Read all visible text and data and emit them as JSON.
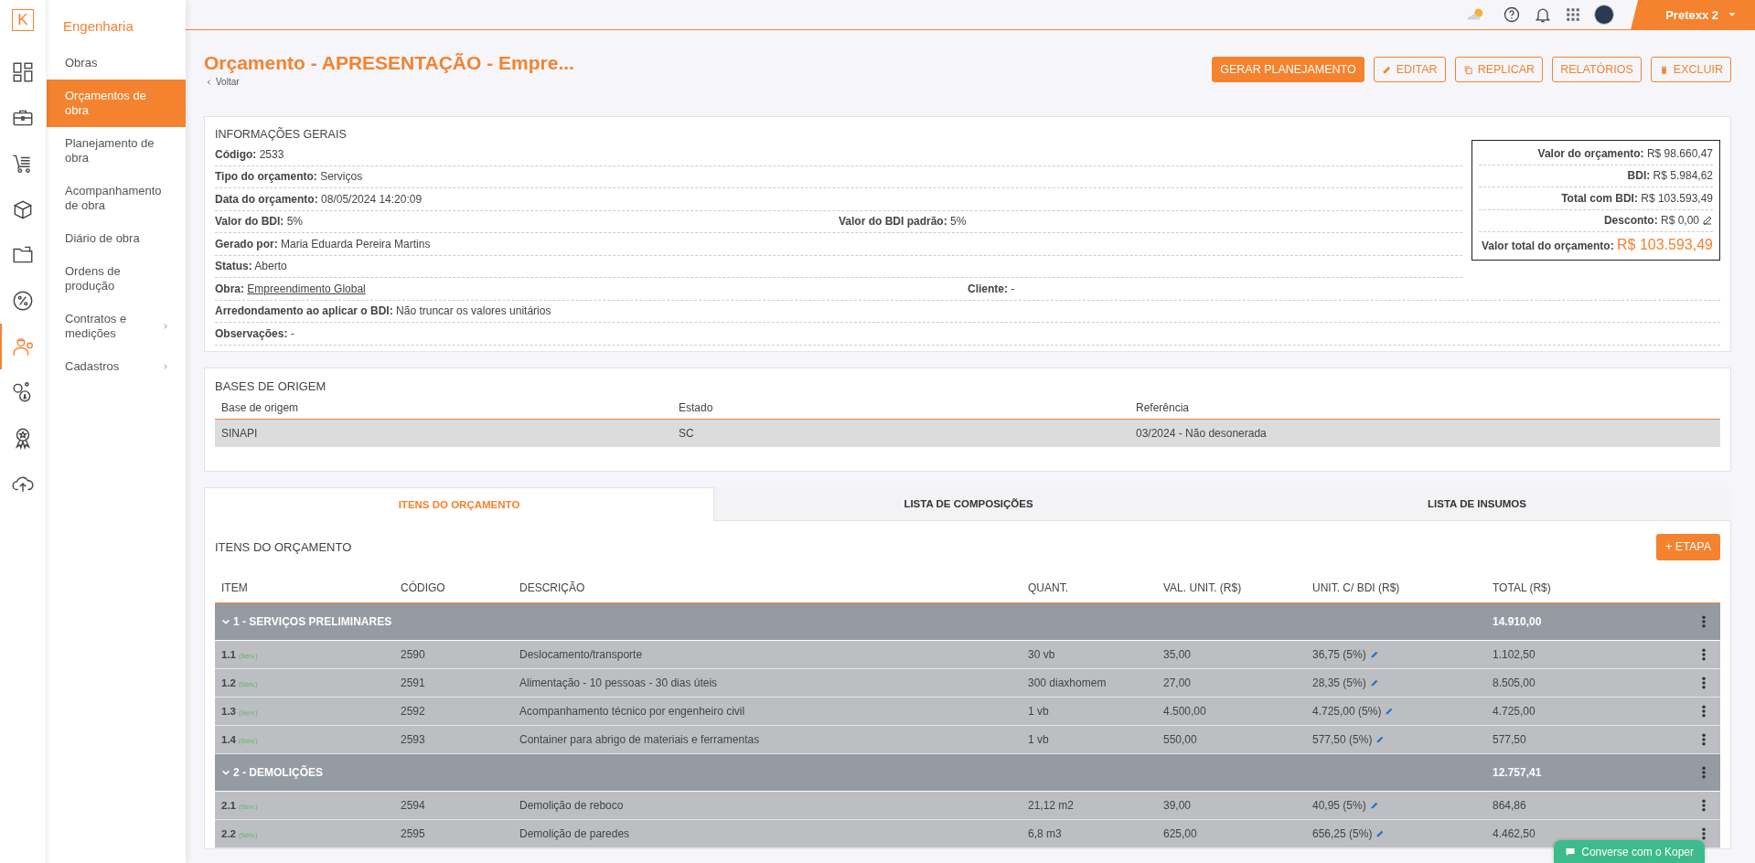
{
  "rail": {
    "logo": "K",
    "items": [
      {
        "selected": false
      },
      {
        "selected": false
      },
      {
        "selected": false
      },
      {
        "selected": false
      },
      {
        "selected": false
      },
      {
        "selected": false
      },
      {
        "selected": true
      },
      {
        "selected": false
      },
      {
        "selected": false
      },
      {
        "selected": false
      }
    ]
  },
  "sidebar": {
    "title": "Engenharia",
    "items": [
      {
        "label": "Obras",
        "selected": false,
        "submenu": false
      },
      {
        "label": "Orçamentos de obra",
        "selected": true,
        "submenu": false
      },
      {
        "label": "Planejamento de obra",
        "selected": false,
        "submenu": false
      },
      {
        "label": "Acompanhamento de obra",
        "selected": false,
        "submenu": false
      },
      {
        "label": "Diário de obra",
        "selected": false,
        "submenu": false
      },
      {
        "label": "Ordens de produção",
        "selected": false,
        "submenu": false
      },
      {
        "label": "Contratos e medições",
        "selected": false,
        "submenu": true
      },
      {
        "label": "Cadastros",
        "selected": false,
        "submenu": true
      }
    ]
  },
  "topbar": {
    "account": "Pretexx 2"
  },
  "header": {
    "title": "Orçamento - APRESENTAÇÃO - Empre...",
    "back": "Voltar",
    "buttons": [
      {
        "label": "GERAR PLANEJAMENTO",
        "kind": "primary"
      },
      {
        "label": "EDITAR",
        "kind": "edit"
      },
      {
        "label": "REPLICAR",
        "kind": "copy"
      },
      {
        "label": "RELATÓRIOS",
        "kind": "plain"
      },
      {
        "label": "EXCLUIR",
        "kind": "delete"
      }
    ]
  },
  "info": {
    "title": "INFORMAÇÕES GERAIS",
    "rows": [
      {
        "fields": [
          {
            "label": "Código:",
            "value": "2533"
          }
        ]
      },
      {
        "fields": [
          {
            "label": "Tipo do orçamento:",
            "value": "Serviços"
          }
        ]
      },
      {
        "fields": [
          {
            "label": "Data do orçamento:",
            "value": "08/05/2024 14:20:09"
          }
        ]
      },
      {
        "fields": [
          {
            "label": "Valor do BDI:",
            "value": "5%"
          },
          {
            "label": "Valor do BDI padrão:",
            "value": "5%"
          }
        ]
      },
      {
        "fields": [
          {
            "label": "Gerado por:",
            "value": "Maria Eduarda Pereira Martins"
          }
        ]
      },
      {
        "fields": [
          {
            "label": "Status:",
            "value": "Aberto"
          }
        ]
      },
      {
        "fields": [
          {
            "label": "Obra:",
            "value": "Empreendimento Global",
            "link": true
          },
          {
            "label": "Cliente:",
            "value": "-"
          }
        ]
      },
      {
        "fields": [
          {
            "label": "Arredondamento ao aplicar o BDI:",
            "value": "Não truncar os valores unitários"
          }
        ]
      },
      {
        "fields": [
          {
            "label": "Observações:",
            "value": "-"
          }
        ]
      }
    ],
    "summary": [
      {
        "label": "Valor do orçamento:",
        "value": "R$ 98.660,47",
        "kind": "plain"
      },
      {
        "label": "BDI:",
        "value": "R$ 5.984,62",
        "kind": "plain"
      },
      {
        "label": "Total com BDI:",
        "value": "R$ 103.593,49",
        "kind": "plain"
      },
      {
        "label": "Desconto:",
        "value": "R$ 0,00",
        "kind": "editable"
      },
      {
        "label": "Valor total do orçamento:",
        "value": "R$ 103.593,49",
        "kind": "total"
      }
    ]
  },
  "bases": {
    "title": "BASES DE ORIGEM",
    "columns": [
      "Base de origem",
      "Estado",
      "Referência"
    ],
    "rows": [
      [
        "SINAPI",
        "SC",
        "03/2024 - Não desonerada"
      ]
    ]
  },
  "tabs": [
    {
      "label": "ITENS DO ORÇAMENTO",
      "selected": true
    },
    {
      "label": "LISTA DE COMPOSIÇÕES",
      "selected": false
    },
    {
      "label": "LISTA DE INSUMOS",
      "selected": false
    }
  ],
  "items": {
    "title": "ITENS DO ORÇAMENTO",
    "add_button": "+ ETAPA",
    "columns": [
      "ITEM",
      "CÓDIGO",
      "DESCRIÇÃO",
      "QUANT.",
      "VAL. UNIT. (R$)",
      "UNIT. C/ BDI (R$)",
      "TOTAL (R$)"
    ],
    "groups": [
      {
        "label": "1 - SERVIÇOS PRELIMINARES",
        "total": "14.910,00",
        "expanded": true,
        "rows": [
          {
            "item": "1.1",
            "type": "(Serv.)",
            "code": "2590",
            "description": "Deslocamento/transporte",
            "quantity": "30 vb",
            "unit_value": "35,00",
            "bdi_value": "36,75 (5%)",
            "total": "1.102,50"
          },
          {
            "item": "1.2",
            "type": "(Serv.)",
            "code": "2591",
            "description": "Alimentação - 10 pessoas - 30 dias úteis",
            "quantity": "300 diaxhomem",
            "unit_value": "27,00",
            "bdi_value": "28,35 (5%)",
            "total": "8.505,00"
          },
          {
            "item": "1.3",
            "type": "(Serv.)",
            "code": "2592",
            "description": "Acompanhamento técnico por engenheiro civil",
            "quantity": "1 vb",
            "unit_value": "4.500,00",
            "bdi_value": "4.725,00 (5%)",
            "total": "4.725,00"
          },
          {
            "item": "1.4",
            "type": "(Serv.)",
            "code": "2593",
            "description": "Container para abrigo de materiais e ferramentas",
            "quantity": "1 vb",
            "unit_value": "550,00",
            "bdi_value": "577,50 (5%)",
            "total": "577,50"
          }
        ]
      },
      {
        "label": "2 - DEMOLIÇÕES",
        "total": "12.757,41",
        "expanded": true,
        "rows": [
          {
            "item": "2.1",
            "type": "(Serv.)",
            "code": "2594",
            "description": "Demolição de reboco",
            "quantity": "21,12 m2",
            "unit_value": "39,00",
            "bdi_value": "40,95 (5%)",
            "total": "864,86"
          },
          {
            "item": "2.2",
            "type": "(Serv.)",
            "code": "2595",
            "description": "Demolição de paredes",
            "quantity": "6,8 m3",
            "unit_value": "625,00",
            "bdi_value": "656,25 (5%)",
            "total": "4.462,50"
          }
        ]
      }
    ]
  },
  "chat": {
    "label": "Converse com o Koper"
  }
}
